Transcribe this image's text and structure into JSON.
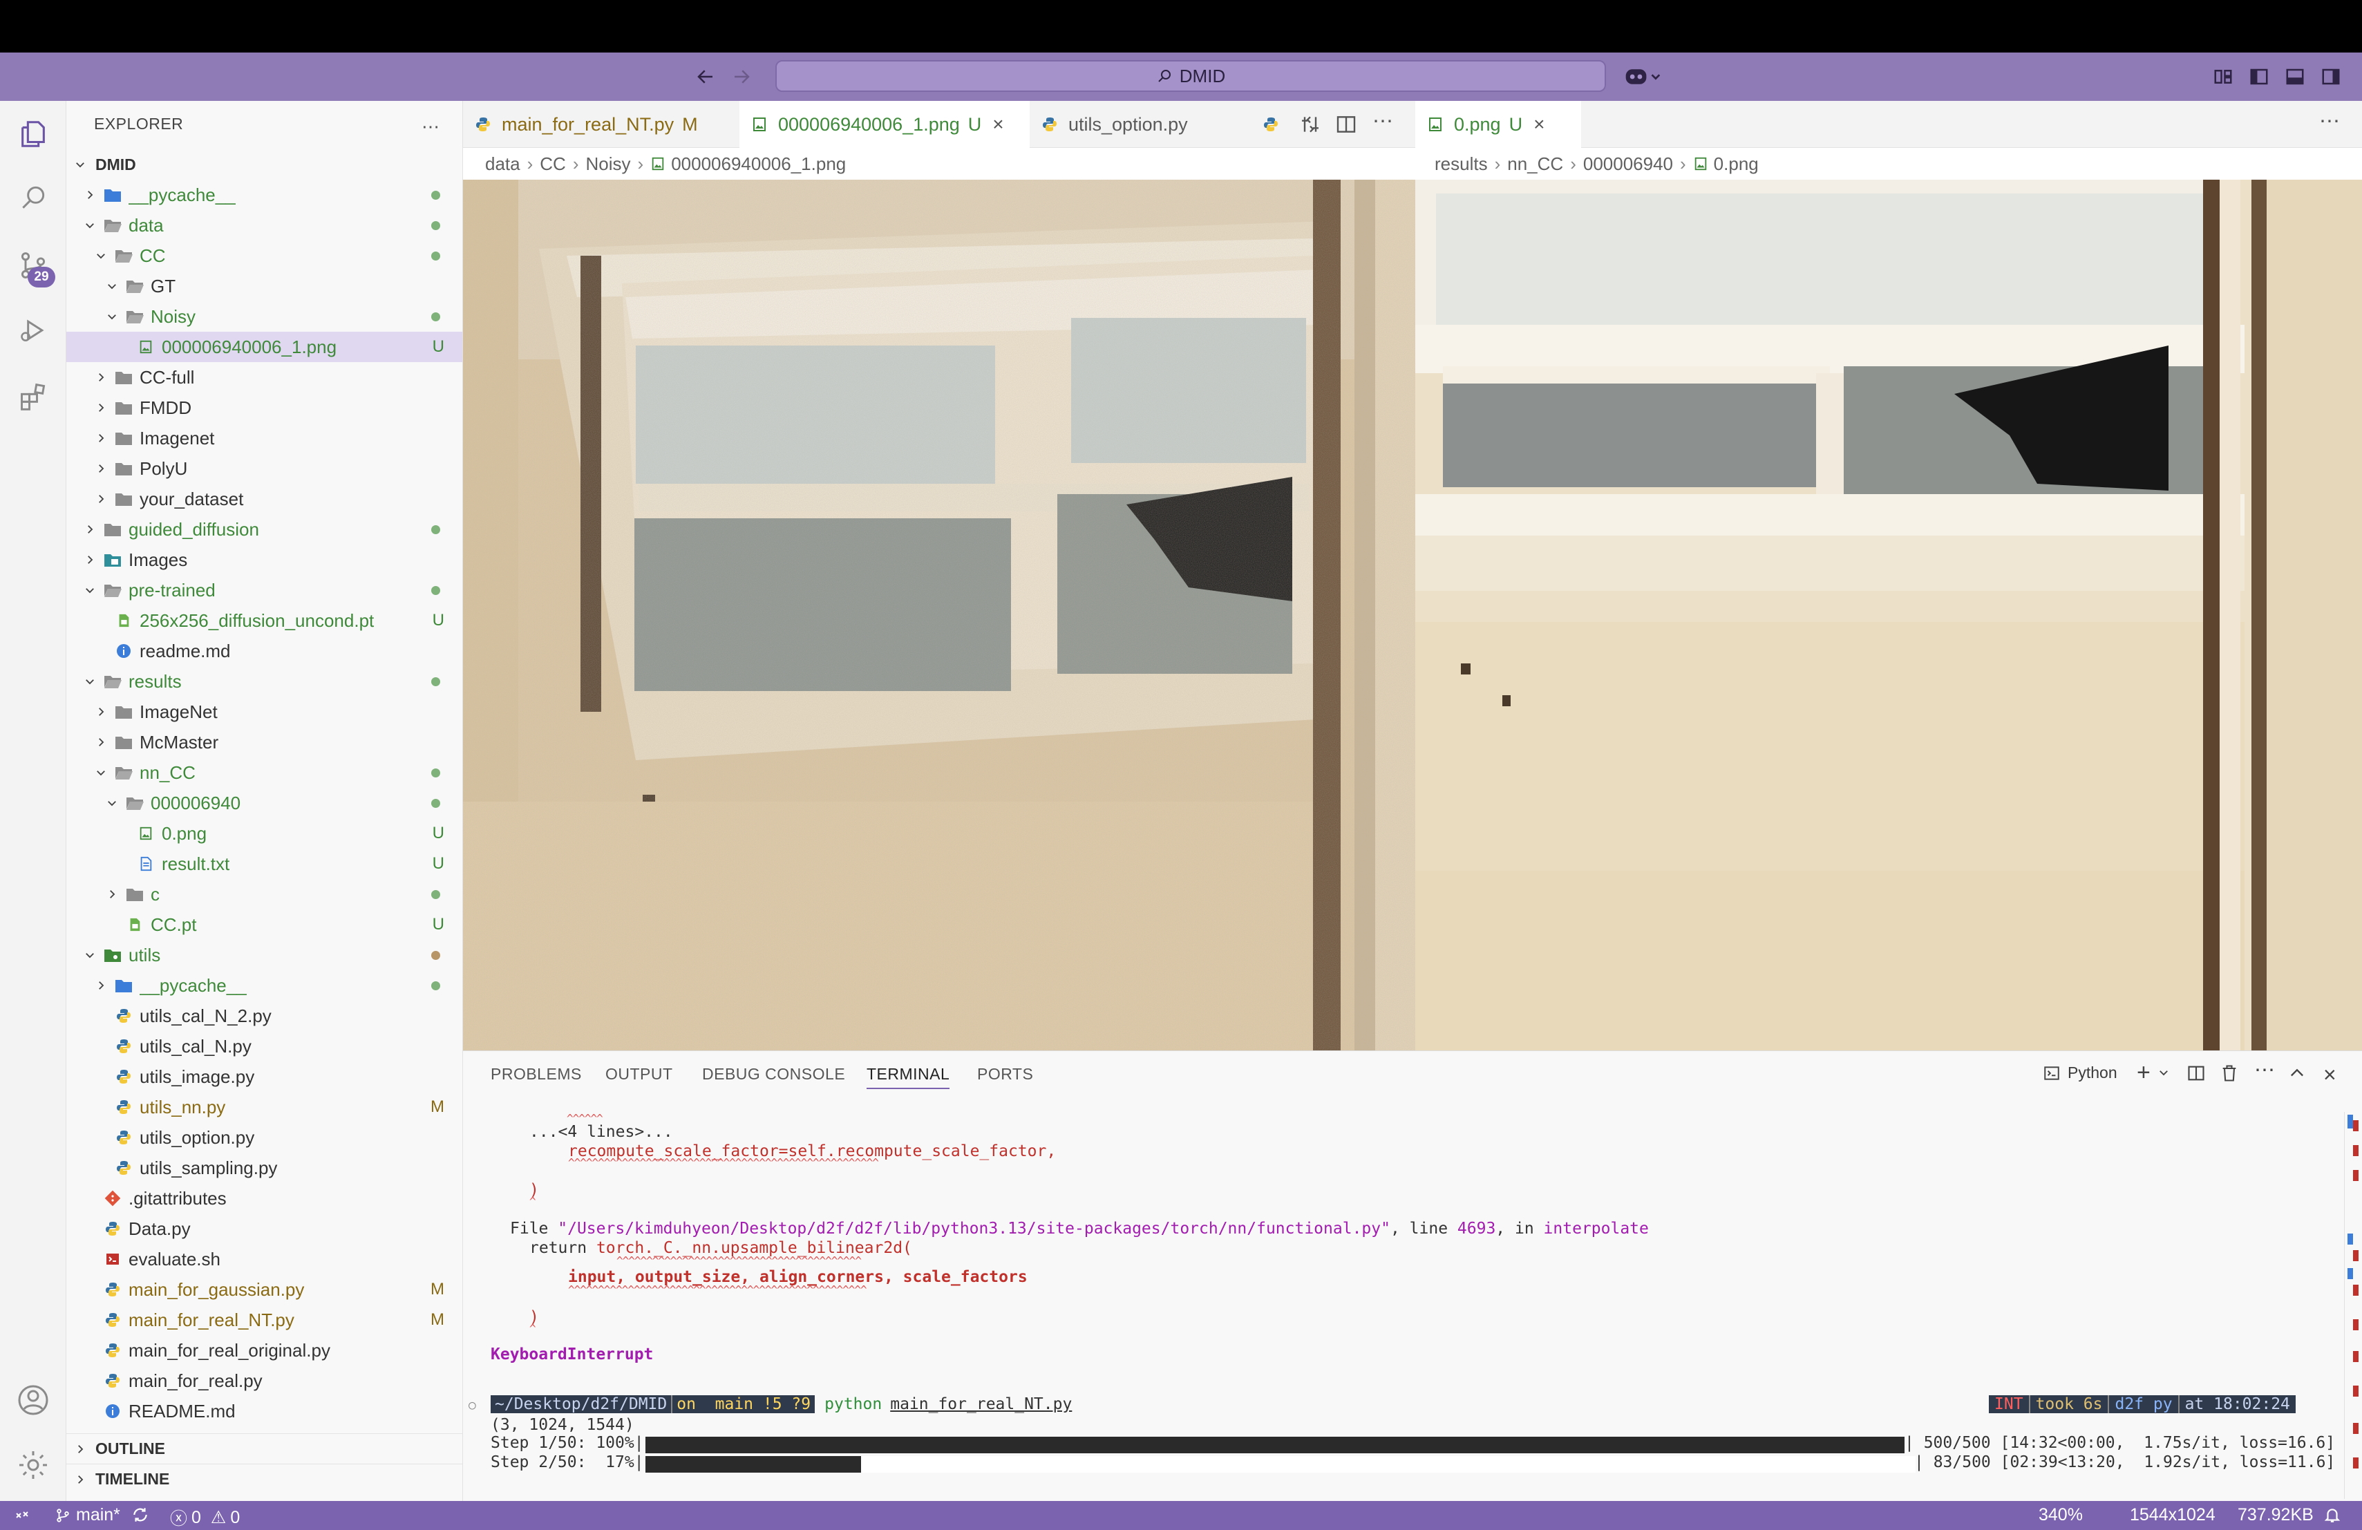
{
  "titlebar": {
    "search_text": "DMID"
  },
  "activity": {
    "source_control_badge": "29"
  },
  "explorer": {
    "title": "EXPLORER",
    "root": "DMID",
    "items": [
      {
        "label": "__pycache__",
        "depth": 1,
        "kind": "folder-py",
        "open": false,
        "status": "dot"
      },
      {
        "label": "data",
        "depth": 1,
        "kind": "folder",
        "open": true,
        "status": "dot"
      },
      {
        "label": "CC",
        "depth": 2,
        "kind": "folder",
        "open": true,
        "status": "dot"
      },
      {
        "label": "GT",
        "depth": 3,
        "kind": "folder",
        "open": true,
        "status": ""
      },
      {
        "label": "Noisy",
        "depth": 3,
        "kind": "folder",
        "open": true,
        "status": "dot"
      },
      {
        "label": "000006940006_1.png",
        "depth": 4,
        "kind": "image",
        "status": "U",
        "selected": true
      },
      {
        "label": "CC-full",
        "depth": 2,
        "kind": "folder",
        "open": false,
        "status": ""
      },
      {
        "label": "FMDD",
        "depth": 2,
        "kind": "folder",
        "open": false,
        "status": ""
      },
      {
        "label": "Imagenet",
        "depth": 2,
        "kind": "folder",
        "open": false,
        "status": ""
      },
      {
        "label": "PolyU",
        "depth": 2,
        "kind": "folder",
        "open": false,
        "status": ""
      },
      {
        "label": "your_dataset",
        "depth": 2,
        "kind": "folder",
        "open": false,
        "status": ""
      },
      {
        "label": "guided_diffusion",
        "depth": 1,
        "kind": "folder",
        "open": false,
        "status": "dot"
      },
      {
        "label": "Images",
        "depth": 1,
        "kind": "folder-img",
        "open": false,
        "status": ""
      },
      {
        "label": "pre-trained",
        "depth": 1,
        "kind": "folder",
        "open": true,
        "status": "dot"
      },
      {
        "label": "256x256_diffusion_uncond.pt",
        "depth": 2,
        "kind": "pt",
        "status": "U"
      },
      {
        "label": "readme.md",
        "depth": 2,
        "kind": "info",
        "status": ""
      },
      {
        "label": "results",
        "depth": 1,
        "kind": "folder",
        "open": true,
        "status": "dot"
      },
      {
        "label": "ImageNet",
        "depth": 2,
        "kind": "folder",
        "open": false,
        "status": ""
      },
      {
        "label": "McMaster",
        "depth": 2,
        "kind": "folder",
        "open": false,
        "status": ""
      },
      {
        "label": "nn_CC",
        "depth": 2,
        "kind": "folder",
        "open": true,
        "status": "dot"
      },
      {
        "label": "000006940",
        "depth": 3,
        "kind": "folder",
        "open": true,
        "status": "dot"
      },
      {
        "label": "0.png",
        "depth": 4,
        "kind": "image",
        "status": "U"
      },
      {
        "label": "result.txt",
        "depth": 4,
        "kind": "text",
        "status": "U"
      },
      {
        "label": "c",
        "depth": 3,
        "kind": "folder",
        "open": false,
        "status": "dot"
      },
      {
        "label": "CC.pt",
        "depth": 3,
        "kind": "pt",
        "status": "U"
      },
      {
        "label": "utils",
        "depth": 1,
        "kind": "folder-utils",
        "open": true,
        "status": "dot-brown"
      },
      {
        "label": "__pycache__",
        "depth": 2,
        "kind": "folder-py",
        "open": false,
        "status": "dot"
      },
      {
        "label": "utils_cal_N_2.py",
        "depth": 2,
        "kind": "py",
        "status": ""
      },
      {
        "label": "utils_cal_N.py",
        "depth": 2,
        "kind": "py",
        "status": ""
      },
      {
        "label": "utils_image.py",
        "depth": 2,
        "kind": "py",
        "status": ""
      },
      {
        "label": "utils_nn.py",
        "depth": 2,
        "kind": "py",
        "status": "M"
      },
      {
        "label": "utils_option.py",
        "depth": 2,
        "kind": "py",
        "status": ""
      },
      {
        "label": "utils_sampling.py",
        "depth": 2,
        "kind": "py",
        "status": ""
      },
      {
        "label": ".gitattributes",
        "depth": 1,
        "kind": "git",
        "status": ""
      },
      {
        "label": "Data.py",
        "depth": 1,
        "kind": "py",
        "status": ""
      },
      {
        "label": "evaluate.sh",
        "depth": 1,
        "kind": "sh",
        "status": ""
      },
      {
        "label": "main_for_gaussian.py",
        "depth": 1,
        "kind": "py",
        "status": "M"
      },
      {
        "label": "main_for_real_NT.py",
        "depth": 1,
        "kind": "py",
        "status": "M"
      },
      {
        "label": "main_for_real_original.py",
        "depth": 1,
        "kind": "py",
        "status": ""
      },
      {
        "label": "main_for_real.py",
        "depth": 1,
        "kind": "py",
        "status": ""
      },
      {
        "label": "README.md",
        "depth": 1,
        "kind": "info",
        "status": ""
      }
    ],
    "outline": "OUTLINE",
    "timeline": "TIMELINE"
  },
  "editor_left": {
    "tabs": [
      {
        "label": "main_for_real_NT.py",
        "status": "M"
      },
      {
        "label": "000006940006_1.png",
        "status": "U"
      },
      {
        "label": "utils_option.py",
        "status": ""
      }
    ],
    "breadcrumb": [
      "data",
      "CC",
      "Noisy",
      "000006940006_1.png"
    ]
  },
  "editor_right": {
    "tabs": [
      {
        "label": "0.png",
        "status": "U"
      }
    ],
    "breadcrumb": [
      "results",
      "nn_CC",
      "000006940",
      "0.png"
    ]
  },
  "panel": {
    "tabs": [
      "PROBLEMS",
      "OUTPUT",
      "DEBUG CONSOLE",
      "TERMINAL",
      "PORTS"
    ],
    "active_tab": "TERMINAL",
    "shell_label": "Python",
    "terminal": {
      "lines_prefix_4": "...<4 lines>...",
      "recompute": "recompute_scale_factor=self.recompute_scale_factor,",
      "paren1": ")",
      "file_prefix": "File ",
      "file_path": "\"/Users/kimduhyeon/Desktop/d2f/d2f/lib/python3.13/site-packages/torch/nn/functional.py\"",
      "file_line_word": ", line ",
      "file_line_no": "4693",
      "file_in": ", in ",
      "file_func": "interpolate",
      "return_kw": "return ",
      "return_call": "torch._C._nn.upsample_bilinear2d(",
      "args": "input, output_size, align_corners, scale_factors",
      "paren2": ")",
      "keyboard": "KeyboardInterrupt",
      "prompt_path": "~/Desktop/d2f/DMID",
      "prompt_git": "on  main !5 ?9",
      "prompt_cmd": "python",
      "prompt_arg": "main_for_real_NT.py",
      "rprompt_int": "INT",
      "rprompt_took": "took 6s",
      "rprompt_env": "d2f py",
      "rprompt_time": "at 18:02:24",
      "shape": "(3, 1024, 1544)",
      "step1_label": "Step 1/50: 100%|",
      "step1_stats": "| 500/500 [14:32<00:00,  1.75s/it, loss=16.6]",
      "step1_progress": 1.0,
      "step2_label": "Step 2/50:  17%|",
      "step2_stats": "| 83/500 [02:39<13:20,  1.92s/it, loss=11.6]",
      "step2_progress": 0.17
    }
  },
  "statusbar": {
    "branch": "main*",
    "errors": "0",
    "warnings": "0",
    "zoom": "340%",
    "dims": "1544x1024",
    "size": "737.92KB"
  },
  "colors": {
    "accent": "#7b63b0",
    "titlebar": "#8f7bb5",
    "git_untracked": "#3f8a3a",
    "git_modified": "#8a6a12"
  }
}
